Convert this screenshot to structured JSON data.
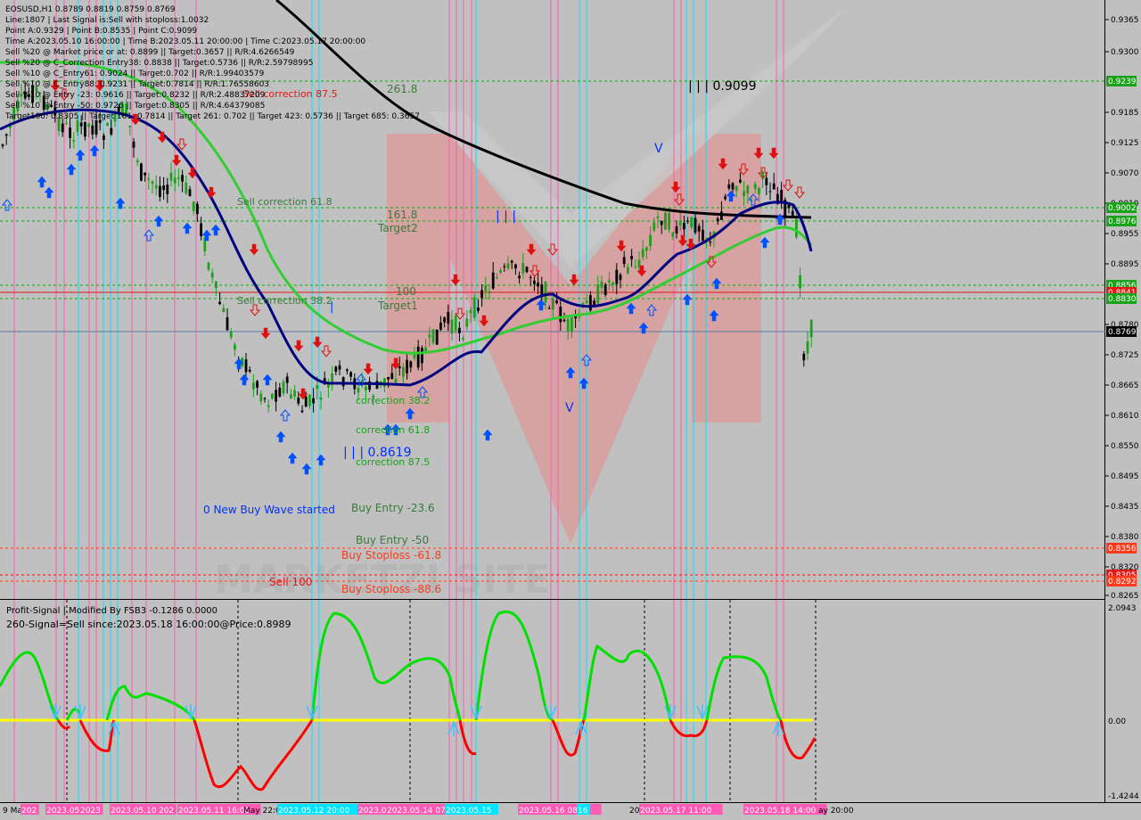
{
  "header": {
    "lines": [
      "EOSUSD,H1  0.8789 0.8819 0.8759 0.8769",
      "Line:1807 | Last Signal is:Sell with stoploss:1.0032",
      "Point A:0.9329 | Point B:0.8535 | Point C:0.9099",
      "Time A:2023.05.10 16:00:00 | Time B:2023.05.11 20:00:00 | Time C:2023.05.17 20:00:00",
      "Sell %20 @ Market price or at: 0.8899 || Target:0.3657 || R/R:4.6266549",
      "Sell %20 @ C_Correction Entry38: 0.8838 || Target:0.5736 || R/R:2.59798995",
      "Sell %10 @ C_Entry61: 0.9024 || Target:0.702 || R/R:1.99403579",
      "Sell %10 @ C_Entry88: 0.9231 || Target:0.7814 || R/R:1.76558603",
      "Sell %10 @ Entry -23: 0.9616 || Target:0.8232 || R/R:2.48837209",
      "Sell %10 @ Entry -50: 0.9726 || Target:0.8305 || R/R:4.64379085",
      "Target100: 0.8305 || Target 161: 0.7814 || Target 261: 0.702 || Target 423: 0.5736 || Target 685: 0.3657"
    ]
  },
  "chart_labels": {
    "sell_correction_875": "Sell correction 87.5",
    "fib_2618": "261.8",
    "point_c": "| | | 0.9099",
    "sell_correction_618": "Sell correction 61.8",
    "fib_1618": "161.8",
    "target2": "Target2",
    "iii_mark": "| | |",
    "fib_100": "100",
    "target1": "Target1",
    "sell_correction_382": "Sell correction 38.2",
    "i_mark": "|",
    "v_mark_top": "V",
    "v_mark_bottom": "V",
    "correction_382": "correction 38.2",
    "correction_618": "correction 61.8",
    "point_b": "| | | 0.8619",
    "correction_875": "correction 87.5",
    "new_buy_wave": "0 New Buy Wave started",
    "buy_entry_236": "Buy Entry -23.6",
    "buy_entry_50": "Buy Entry -50",
    "buy_stoploss_618": "Buy Stoploss -61.8",
    "sell_100": "Sell 100",
    "buy_stoploss_886": "Buy Stoploss -88.6",
    "watermark": "MARKETZI SITE"
  },
  "price_axis": {
    "ticks": [
      "0.9365",
      "0.9300",
      "0.9185",
      "0.9125",
      "0.9070",
      "0.9010",
      "0.8955",
      "0.8895",
      "0.8780",
      "0.8725",
      "0.8665",
      "0.8610",
      "0.8550",
      "0.8495",
      "0.8435",
      "0.8380",
      "0.8320",
      "0.8265"
    ],
    "highlight_labels": [
      {
        "text": "0.9239",
        "color": "#1aa21a"
      },
      {
        "text": "0.9002",
        "color": "#1aa21a"
      },
      {
        "text": "0.8976",
        "color": "#1aa21a"
      },
      {
        "text": "0.8856",
        "color": "#1aa21a"
      },
      {
        "text": "0.8841",
        "color": "#e01818"
      },
      {
        "text": "0.8830",
        "color": "#1aa21a"
      },
      {
        "text": "0.8769",
        "color": "#000000"
      },
      {
        "text": "0.8356",
        "color": "#ff3a1a"
      },
      {
        "text": "0.8305",
        "color": "#e01818"
      },
      {
        "text": "0.8292",
        "color": "#ff3a1a"
      }
    ]
  },
  "indicator": {
    "title": "Profit-Signal | Modified By FSB3 -0.1286 0.0000",
    "signal": "260-Signal=Sell since:2023.05.18 16:00:00@Price:0.8989",
    "axis": [
      "2.0943",
      "0.00",
      "-1.4244"
    ]
  },
  "time_axis": {
    "labels": [
      "9 Ma",
      "202",
      "2023.05",
      "2023",
      "2023.05.10",
      "202",
      "2023.05.11 16:00",
      "May 22:00",
      "2023.05.12 20:00",
      "2023.05.13 20:00",
      "2023.05.14 07:00",
      "2023.05.15",
      "2023.05.16 08:00",
      "16",
      "2023.05",
      "2023.05.17 11:00",
      "2023.05.18 14:00",
      "ay 20:00"
    ]
  },
  "colors": {
    "background": "#c0c0c0",
    "bull_candle": "#1ea01e",
    "bear_candle": "#000000",
    "ma_fast": "#000080",
    "ma_mid": "#32cd32",
    "ma_slow": "#000000",
    "buy_arrow": "#0050ff",
    "sell_arrow": "#e01010",
    "vline_magenta": "#ff5ab4",
    "vline_cyan": "#00e5ff",
    "osc_up": "#00e000",
    "osc_down": "#ff0000",
    "zero_line": "#ffff00"
  }
}
